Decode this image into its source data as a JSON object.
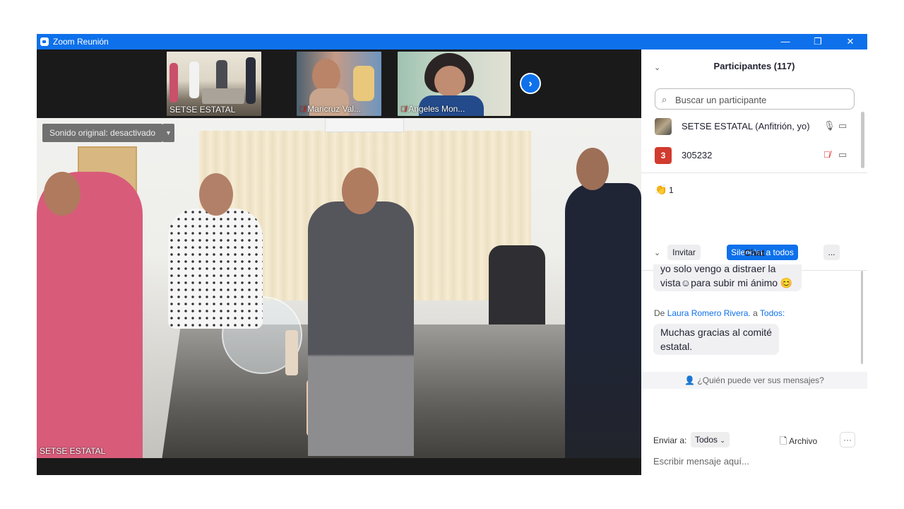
{
  "window": {
    "title": "Zoom Reunión",
    "minimize_glyph": "—",
    "restore_glyph": "❐",
    "close_glyph": "✕",
    "accent_color": "#0e71eb"
  },
  "gallery": {
    "thumbnails": [
      {
        "name": "SETSE ESTATAL",
        "muted": false,
        "active": true
      },
      {
        "name": "Maricruz Val...",
        "muted": true,
        "active": false
      },
      {
        "name": "Angeles Mon...",
        "muted": true,
        "active": false
      }
    ],
    "next_icon": "chevron-right-icon"
  },
  "main_video": {
    "original_sound": "Sonido original: desactivado",
    "speaker_name": "SETSE ESTATAL"
  },
  "participants": {
    "header": "Participantes (117)",
    "search_placeholder": "Buscar un participante",
    "list": [
      {
        "name": "SETSE ESTATAL (Anfitrión, yo)",
        "avatar_text": "",
        "mic": "mic-on",
        "video": "video-off"
      },
      {
        "name": "305232",
        "avatar_text": "3",
        "avatar_color": "#d23b2f",
        "mic": "mic-muted",
        "video": "video-off"
      }
    ],
    "reaction_emoji": "👏",
    "reaction_count": "1",
    "invite_label": "Invitar",
    "mute_all_label": "Silenciar a todos",
    "more_label": "..."
  },
  "chat": {
    "header": "Chat",
    "messages": [
      {
        "text": "yo solo vengo a distraer la vista☺para subir mi ánimo 😊"
      },
      {
        "from_prefix": "De",
        "sender": "Laura Romero Rivera.",
        "to_prefix": "a",
        "recipient": "Todos:",
        "text": "Muchas gracias al comité estatal."
      }
    ],
    "who_can_see": "¿Quién puede ver sus mensajes?",
    "send_to_label": "Enviar a:",
    "send_to_value": "Todos",
    "file_label": "Archivo",
    "more_label": "···",
    "input_placeholder": "Escribir mensaje aquí..."
  }
}
